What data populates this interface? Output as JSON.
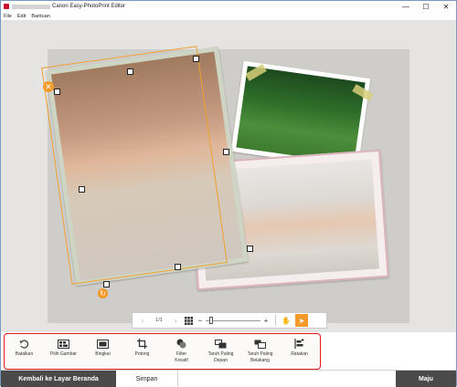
{
  "window": {
    "title": "Canon Easy-PhotoPrint Editor",
    "minimize_glyph": "—",
    "maximize_glyph": "☐",
    "close_glyph": "✕"
  },
  "menu": [
    "File",
    "Edit",
    "Bantuan"
  ],
  "canvas": {
    "delete_glyph": "✕",
    "rotate_glyph": "↻"
  },
  "zoombar": {
    "prev_glyph": "‹",
    "page": "1/1",
    "next_glyph": "›",
    "zoom_out_glyph": "−",
    "zoom_in_glyph": "+",
    "zoom_level": 0.08,
    "hand_glyph": "✋",
    "pointer_glyph": "➤"
  },
  "toolbar": [
    {
      "label": "Batalkan",
      "icon": "undo-icon"
    },
    {
      "label": "Pilih Gambar",
      "icon": "select-image-icon"
    },
    {
      "label": "Bingkai",
      "icon": "frame-icon"
    },
    {
      "label": "Potong",
      "icon": "crop-icon"
    },
    {
      "label": "Filter\nKreatif",
      "icon": "filter-icon"
    },
    {
      "label": "Taruh Paling\nDepan",
      "icon": "bring-to-front-icon"
    },
    {
      "label": "Taruh Paling\nBelakang",
      "icon": "send-to-back-icon"
    },
    {
      "label": "Ratakan",
      "icon": "align-icon"
    }
  ],
  "bottom": {
    "home_label": "Kembali ke Layar Beranda",
    "save_label": "Simpan",
    "next_label": "Maju"
  },
  "colors": {
    "accent": "#f39a2a",
    "highlight": "#e3191c",
    "dark_button": "#4a4a4a"
  }
}
